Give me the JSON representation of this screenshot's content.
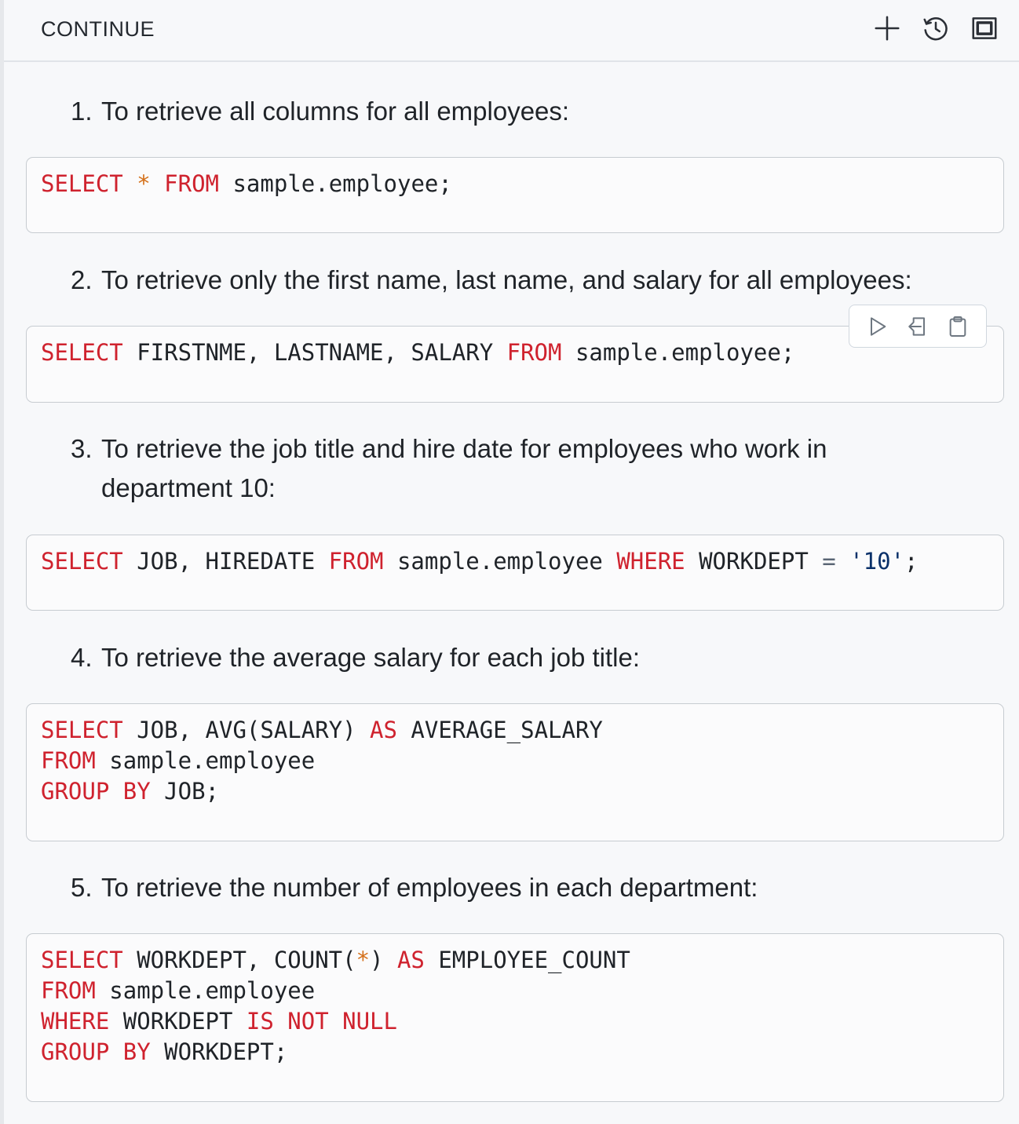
{
  "header": {
    "title": "CONTINUE",
    "icons": [
      "plus-icon",
      "history-icon",
      "fullscreen-icon"
    ]
  },
  "items": [
    {
      "number": "1.",
      "text": "To retrieve all columns for all employees:",
      "code": "SELECT * FROM sample.employee;"
    },
    {
      "number": "2.",
      "text": "To retrieve only the first name, last name, and salary for all employees:",
      "code": "SELECT FIRSTNME, LASTNAME, SALARY FROM sample.employee;"
    },
    {
      "number": "3.",
      "text_line1": "To retrieve the job title and hire date for employees who work in",
      "text_line2": "department 10:",
      "code": "SELECT JOB, HIREDATE FROM sample.employee WHERE WORKDEPT = '10';"
    },
    {
      "number": "4.",
      "text": "To retrieve the average salary for each job title:",
      "code": "SELECT JOB, AVG(SALARY) AS AVERAGE_SALARY\nFROM sample.employee\nGROUP BY JOB;"
    },
    {
      "number": "5.",
      "text": "To retrieve the number of employees in each department:",
      "code": "SELECT WORKDEPT, COUNT(*) AS EMPLOYEE_COUNT\nFROM sample.employee\nWHERE WORKDEPT IS NOT NULL\nGROUP BY WORKDEPT;"
    }
  ],
  "code_toolbar": {
    "buttons": [
      "run-icon",
      "insert-icon",
      "copy-icon"
    ]
  },
  "colors": {
    "keyword": "#cf222e",
    "operator": "#d4701a",
    "string": "#0a3069",
    "background": "#f7f8fa"
  }
}
